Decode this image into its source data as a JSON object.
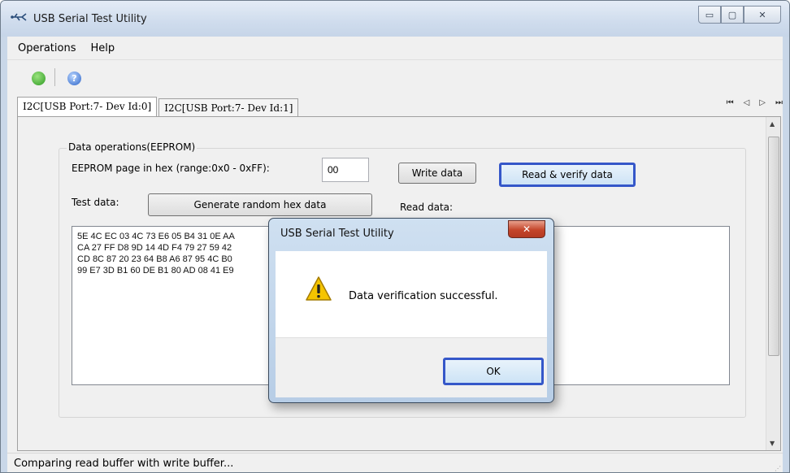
{
  "window": {
    "title": "USB Serial Test Utility",
    "minimize_glyph": "▭",
    "maximize_glyph": "▢",
    "close_glyph": "✕"
  },
  "menu": {
    "items": [
      "Operations",
      "Help"
    ]
  },
  "toolbar": {
    "refresh_icon": "refresh-icon",
    "help_icon": "help-icon",
    "help_glyph": "?"
  },
  "tabs": [
    {
      "label": "I2C[USB Port:7- Dev Id:0]",
      "active": true
    },
    {
      "label": "I2C[USB Port:7- Dev Id:1]",
      "active": false
    }
  ],
  "tab_nav": {
    "first": "⏮",
    "prev": "◁",
    "next": "▷",
    "last": "⏭"
  },
  "eeprom": {
    "group_label": "Data operations(EEPROM)",
    "page_label": "EEPROM page in hex (range:0x0 - 0xFF):",
    "page_value": "00",
    "write_button": "Write data",
    "read_verify_button": "Read & verify data",
    "test_data_label": "Test data:",
    "generate_button": "Generate random hex data",
    "read_data_label": "Read data:",
    "test_data": "5E 4C EC 03 4C 73 E6 05 B4 31 0E AA\nCA 27 FF D8 9D 14 4D F4 79 27 59 42\nCD 8C 87 20 23 64 B8 A6 87 95 4C B0\n99 E7 3D B1 60 DE B1 80 AD 08 41 E9",
    "read_data": ""
  },
  "status": {
    "text": "Comparing read buffer with write buffer..."
  },
  "dialog": {
    "title": "USB Serial Test Utility",
    "close_glyph": "✕",
    "message": "Data verification successful.",
    "ok_button": "OK",
    "icon": "warning-icon"
  },
  "colors": {
    "focus_border": "#3557c9",
    "dialog_close": "#c4452a",
    "title_bar": "#cfdced"
  }
}
